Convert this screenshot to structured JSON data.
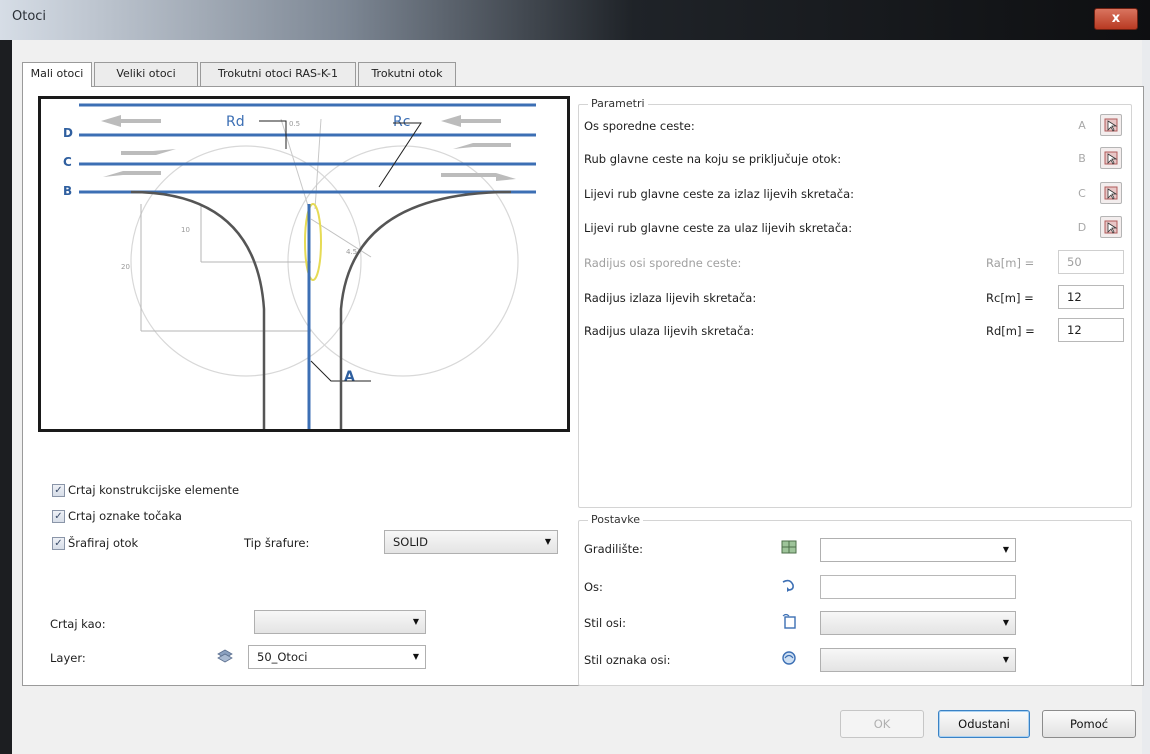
{
  "window": {
    "title": "Otoci",
    "close_label": "x"
  },
  "tabs": [
    {
      "label": "Mali otoci",
      "active": true
    },
    {
      "label": "Veliki otoci",
      "active": false
    },
    {
      "label": "Trokutni otoci RAS-K-1",
      "active": false
    },
    {
      "label": "Trokutni otok",
      "active": false
    }
  ],
  "diagram": {
    "labels": {
      "D": "D",
      "C": "C",
      "B": "B",
      "A": "A",
      "Rd": "Rd",
      "Rc": "Rc"
    },
    "dims": {
      "top": "0.5",
      "side1": "10",
      "side2": "20",
      "angle": "4.5"
    }
  },
  "parametri": {
    "title": "Parametri",
    "rows": [
      {
        "label": "Os sporedne ceste:",
        "letter": "A"
      },
      {
        "label": "Rub glavne ceste na koju se priključuje otok:",
        "letter": "B"
      },
      {
        "label": "Lijevi rub glavne ceste za izlaz lijevih skretača:",
        "letter": "C"
      },
      {
        "label": "Lijevi rub glavne ceste za ulaz lijevih skretača:",
        "letter": "D"
      }
    ],
    "radius": [
      {
        "label": "Radijus osi sporedne ceste:",
        "unit": "Ra[m] =",
        "value": "50",
        "enabled": false
      },
      {
        "label": "Radijus izlaza lijevih skretača:",
        "unit": "Rc[m] =",
        "value": "12",
        "enabled": true
      },
      {
        "label": "Radijus ulaza lijevih skretača:",
        "unit": "Rd[m] =",
        "value": "12",
        "enabled": true
      }
    ]
  },
  "options": {
    "draw_construction": {
      "label": "Crtaj konstrukcijske elemente",
      "checked": true
    },
    "draw_point_labels": {
      "label": "Crtaj oznake točaka",
      "checked": true
    },
    "hatch_island": {
      "label": "Šrafiraj otok",
      "checked": true
    },
    "hatch_type_label": "Tip šrafure:",
    "hatch_type_value": "SOLID",
    "draw_as_label": "Crtaj kao:",
    "draw_as_value": "",
    "layer_label": "Layer:",
    "layer_value": "50_Otoci"
  },
  "postavke": {
    "title": "Postavke",
    "gradiliste_label": "Gradilište:",
    "gradiliste_value": "",
    "os_label": "Os:",
    "os_value": "",
    "stil_osi_label": "Stil osi:",
    "stil_osi_value": "",
    "stil_oznaka_label": "Stil oznaka osi:",
    "stil_oznaka_value": ""
  },
  "buttons": {
    "ok": "OK",
    "cancel": "Odustani",
    "help": "Pomoć"
  }
}
